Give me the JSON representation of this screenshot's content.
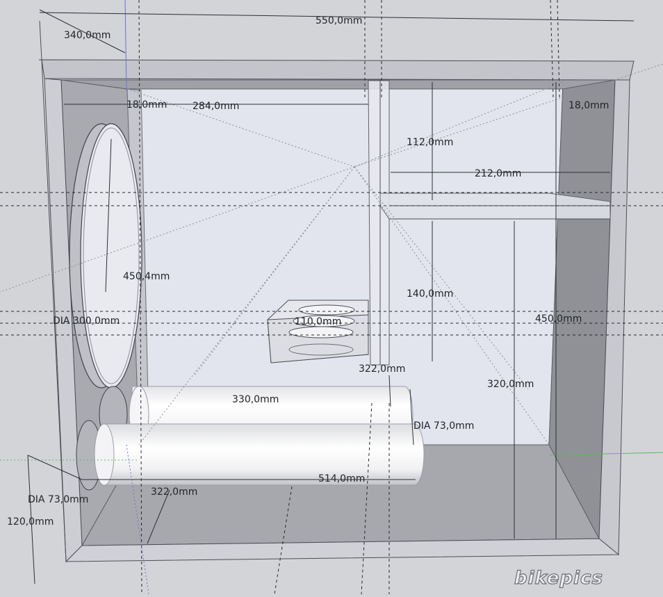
{
  "dimensions": {
    "overall_width": "550,0mm",
    "depth": "340,0mm",
    "left_panel": "18,0mm",
    "right_panel": "18,0mm",
    "chamber_width": "284,0mm",
    "upper_height": "112,0mm",
    "shelf_width": "212,0mm",
    "baffle_height": "450,4mm",
    "speaker_dia": "DIA 300,0mm",
    "small_hole": "110,0mm",
    "internal_height": "450,0mm",
    "lower_height": "140,0mm",
    "block_depth": "322,0mm",
    "port_length_upper": "330,0mm",
    "port_dia_right": "DIA 73,0mm",
    "right_height": "320,0mm",
    "port_length_lower": "514,0mm",
    "port_dia_left": "DIA 73,0mm",
    "bottom_depth": "322,0mm",
    "offset_height": "120,0mm"
  },
  "watermark": "bikepics"
}
